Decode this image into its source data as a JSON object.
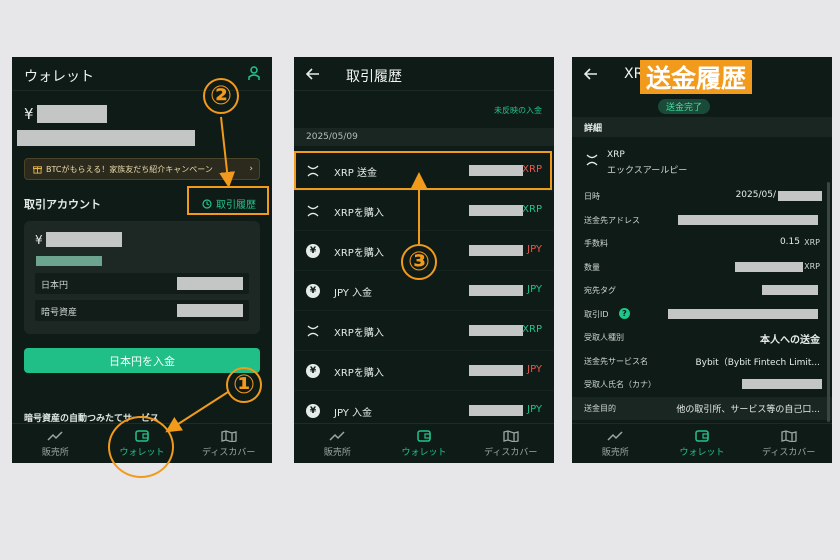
{
  "screen1": {
    "title": "ウォレット",
    "yen_symbol": "¥",
    "campaign": "BTCがもらえる！家族友だち紹介キャンペーン",
    "section_title": "取引アカウント",
    "history_link": "取引履歴",
    "account_yen": "¥",
    "row_jpy": "日本円",
    "row_crypto": "暗号資産",
    "deposit_button": "日本円を入金",
    "bottom_text": "暗号資産の自動つみたてサービス"
  },
  "screen2": {
    "title": "取引履歴",
    "unreflected": "未反映の入金",
    "date": "2025/05/09",
    "rows": [
      {
        "label": "XRP 送金",
        "unit": "XRP",
        "color": "red",
        "icon": "x"
      },
      {
        "label": "XRPを購入",
        "unit": "XRP",
        "color": "green",
        "icon": "x"
      },
      {
        "label": "XRPを購入",
        "unit": "JPY",
        "color": "red",
        "icon": "yen"
      },
      {
        "label": "JPY 入金",
        "unit": "JPY",
        "color": "green",
        "icon": "yen"
      },
      {
        "label": "XRPを購入",
        "unit": "XRP",
        "color": "green",
        "icon": "x"
      },
      {
        "label": "XRPを購入",
        "unit": "JPY",
        "color": "red",
        "icon": "yen"
      },
      {
        "label": "JPY 入金",
        "unit": "JPY",
        "color": "green",
        "icon": "yen"
      }
    ]
  },
  "screen3": {
    "title_partial": "XR",
    "overlay_title": "送金履歴",
    "status": "送金完了",
    "detail_heading": "詳細",
    "coin_name": "XRP",
    "coin_kana": "エックスアールピー",
    "fields": [
      {
        "label": "日時",
        "value": "2025/05/"
      },
      {
        "label": "送金先アドレス",
        "value": ""
      },
      {
        "label": "手数料",
        "value": "0.15",
        "suffix": "XRP"
      },
      {
        "label": "数量",
        "value": "",
        "suffix": "XRP"
      },
      {
        "label": "宛先タグ",
        "value": ""
      },
      {
        "label": "取引ID",
        "value": ""
      },
      {
        "label": "受取人種別",
        "value": "本人への送金"
      },
      {
        "label": "送金先サービス名",
        "value": "Bybit（Bybit Fintech Limit..."
      },
      {
        "label": "受取人氏名（カナ）",
        "value": ""
      },
      {
        "label": "送金目的",
        "value": "他の取引所、サービス等の自己口..."
      }
    ]
  },
  "nav": {
    "market": "販売所",
    "wallet": "ウォレット",
    "discover": "ディスカバー"
  },
  "annotations": {
    "one": "①",
    "two": "②",
    "three": "③"
  },
  "colors": {
    "accent": "#22c48a",
    "annotation": "#f29a1c",
    "bg": "#0f1b17"
  }
}
